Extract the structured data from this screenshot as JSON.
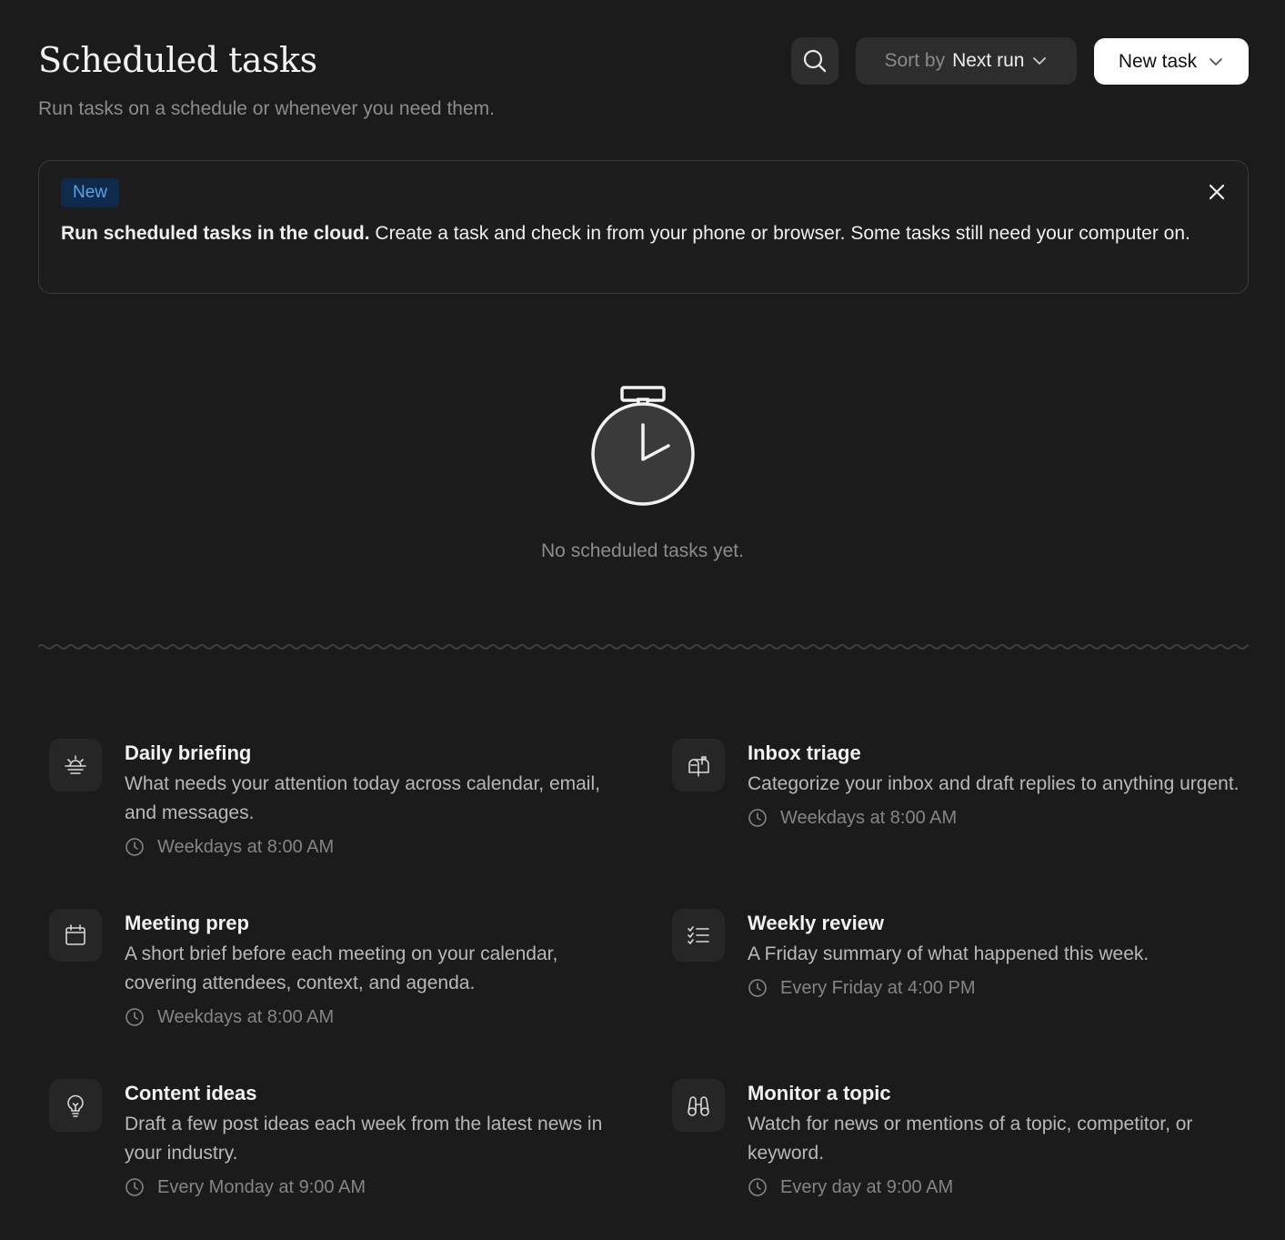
{
  "header": {
    "title": "Scheduled tasks",
    "subtitle": "Run tasks on a schedule or whenever you need them.",
    "sort_prefix": "Sort by",
    "sort_value": "Next run",
    "new_task_label": "New task"
  },
  "banner": {
    "badge": "New",
    "bold_text": "Run scheduled tasks in the cloud.",
    "text": " Create a task and check in from your phone or browser. Some tasks still need your computer on."
  },
  "empty_state": {
    "text": "No scheduled tasks yet."
  },
  "templates": [
    {
      "title": "Daily briefing",
      "description": "What needs your attention today across calendar, email, and messages.",
      "schedule": "Weekdays at 8:00 AM",
      "icon": "sunrise-icon"
    },
    {
      "title": "Inbox triage",
      "description": "Categorize your inbox and draft replies to anything urgent.",
      "schedule": "Weekdays at 8:00 AM",
      "icon": "mailbox-icon"
    },
    {
      "title": "Meeting prep",
      "description": "A short brief before each meeting on your calendar, covering attendees, context, and agenda.",
      "schedule": "Weekdays at 8:00 AM",
      "icon": "calendar-icon"
    },
    {
      "title": "Weekly review",
      "description": "A Friday summary of what happened this week.",
      "schedule": "Every Friday at 4:00 PM",
      "icon": "checklist-icon"
    },
    {
      "title": "Content ideas",
      "description": "Draft a few post ideas each week from the latest news in your industry.",
      "schedule": "Every Monday at 9:00 AM",
      "icon": "lightbulb-icon"
    },
    {
      "title": "Monitor a topic",
      "description": "Watch for news or mentions of a topic, competitor, or keyword.",
      "schedule": "Every day at 9:00 AM",
      "icon": "binoculars-icon"
    }
  ],
  "colors": {
    "background": "#1b1b1b",
    "badge_bg": "#0f2a4a",
    "badge_text": "#5aa2ef"
  }
}
